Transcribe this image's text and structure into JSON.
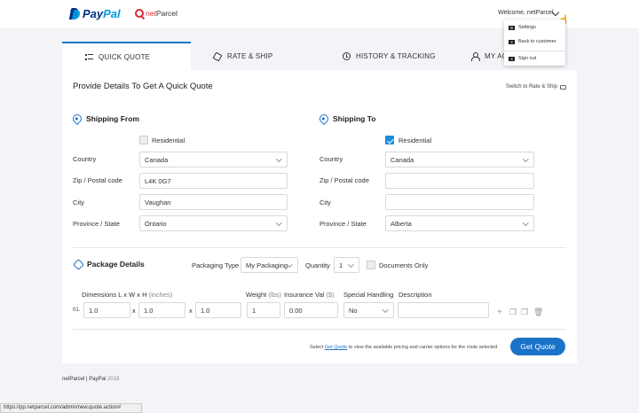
{
  "header": {
    "paypal_a": "Pay",
    "paypal_b": "Pal",
    "netparcel_a": "net",
    "netparcel_b": "Parcel",
    "welcome": "Welcome, netParcel"
  },
  "user_menu": {
    "items": [
      {
        "label": "Settings",
        "icon": "settings-icon"
      },
      {
        "label": "Back to customer",
        "icon": "back-icon"
      },
      {
        "label": "Sign out",
        "icon": "sign-out-icon"
      }
    ]
  },
  "tabs": [
    {
      "label": "QUICK QUOTE",
      "icon": "list-icon",
      "active": true
    },
    {
      "label": "RATE & SHIP",
      "icon": "cube-icon",
      "active": false
    },
    {
      "label": "HISTORY & TRACKING",
      "icon": "clock-icon",
      "active": false
    },
    {
      "label": "MY AC",
      "icon": "user-icon",
      "active": false
    }
  ],
  "panel": {
    "title": "Provide Details To Get A Quick Quote",
    "switch_link": "Switch to Rate & Ship"
  },
  "shipping_from": {
    "heading": "Shipping From",
    "residential_label": "Residential",
    "residential_checked": false,
    "labels": {
      "country": "Country",
      "zip": "Zip / Postal code",
      "city": "City",
      "province": "Province / State"
    },
    "country": "Canada",
    "zip": "L4K 0G7",
    "city": "Vaughan",
    "province": "Ontario"
  },
  "shipping_to": {
    "heading": "Shipping To",
    "residential_label": "Residential",
    "residential_checked": true,
    "labels": {
      "country": "Country",
      "zip": "Zip / Postal code",
      "city": "City",
      "province": "Province / State"
    },
    "country": "Canada",
    "zip": "",
    "city": "",
    "province": "Alberta"
  },
  "package": {
    "heading": "Package Details",
    "packaging_type_label": "Packaging Type",
    "packaging_type": "My Packaging",
    "quantity_label": "Quantity",
    "quantity": "1",
    "documents_only_label": "Documents Only",
    "dimensions_label": "Dimensions L x W x H",
    "dimensions_unit": "(inches)",
    "weight_label": "Weight",
    "weight_unit": "(lbs)",
    "insurance_label": "Insurance Val",
    "insurance_unit": "($)",
    "special_handling_label": "Special Handling",
    "description_label": "Description",
    "row": {
      "index": "01.",
      "length": "1.0",
      "width": "1.0",
      "height": "1.0",
      "x_sep": "x",
      "weight": "1",
      "insurance": "0.00",
      "special_handling": "No",
      "description": ""
    }
  },
  "footer_action": {
    "note_prefix": "Select",
    "note_link": "Get Quote",
    "note_suffix": "to view the available pricing and carrier options for the route selected",
    "button": "Get Quote"
  },
  "footer": {
    "text": "netParcel | PayPal",
    "year": "2019"
  },
  "status_bar": {
    "url": "https://pp.netparcel.com/admin/new.quote.action#"
  },
  "colors": {
    "accent": "#1a73c8",
    "background": "#f2f4f7"
  }
}
